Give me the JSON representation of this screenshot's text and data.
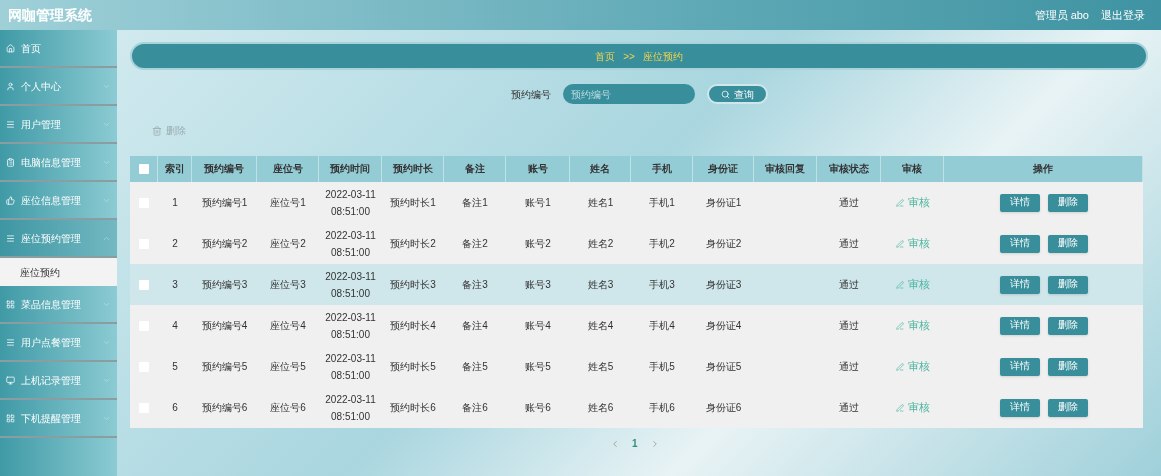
{
  "header": {
    "title": "网咖管理系统",
    "user": "管理员 abo",
    "logout": "退出登录"
  },
  "sidebar": {
    "items": [
      {
        "label": "首页",
        "expandable": false,
        "expanded": false
      },
      {
        "label": "个人中心",
        "expandable": true,
        "expanded": false
      },
      {
        "label": "用户管理",
        "expandable": true,
        "expanded": false
      },
      {
        "label": "电脑信息管理",
        "expandable": true,
        "expanded": false
      },
      {
        "label": "座位信息管理",
        "expandable": true,
        "expanded": false
      },
      {
        "label": "座位预约管理",
        "expandable": true,
        "expanded": true,
        "children": [
          {
            "label": "座位预约",
            "selected": true
          }
        ]
      },
      {
        "label": "菜品信息管理",
        "expandable": true,
        "expanded": false
      },
      {
        "label": "用户点餐管理",
        "expandable": true,
        "expanded": false
      },
      {
        "label": "上机记录管理",
        "expandable": true,
        "expanded": false
      },
      {
        "label": "下机提醒管理",
        "expandable": true,
        "expanded": false
      }
    ]
  },
  "breadcrumb": {
    "home": "首页",
    "separator": ">>",
    "current": "座位预约"
  },
  "search": {
    "label": "预约编号",
    "placeholder": "预约编号",
    "button": "查询"
  },
  "delete_button": "删除",
  "table": {
    "all_checked": false,
    "columns": [
      "索引",
      "预约编号",
      "座位号",
      "预约时间",
      "预约时长",
      "备注",
      "账号",
      "姓名",
      "手机",
      "身份证",
      "审核回复",
      "审核状态",
      "审核",
      "操作"
    ],
    "rows": [
      {
        "checked": false,
        "highlighted": false,
        "cells": [
          "1",
          "预约编号1",
          "座位号1",
          "2022-03-11 08:51:00",
          "预约时长1",
          "备注1",
          "账号1",
          "姓名1",
          "手机1",
          "身份证1",
          "",
          "通过"
        ],
        "review": "审核",
        "actions": [
          "详情",
          "删除"
        ]
      },
      {
        "checked": false,
        "highlighted": false,
        "cells": [
          "2",
          "预约编号2",
          "座位号2",
          "2022-03-11 08:51:00",
          "预约时长2",
          "备注2",
          "账号2",
          "姓名2",
          "手机2",
          "身份证2",
          "",
          "通过"
        ],
        "review": "审核",
        "actions": [
          "详情",
          "删除"
        ]
      },
      {
        "checked": false,
        "highlighted": true,
        "cells": [
          "3",
          "预约编号3",
          "座位号3",
          "2022-03-11 08:51:00",
          "预约时长3",
          "备注3",
          "账号3",
          "姓名3",
          "手机3",
          "身份证3",
          "",
          "通过"
        ],
        "review": "审核",
        "actions": [
          "详情",
          "删除"
        ]
      },
      {
        "checked": false,
        "highlighted": false,
        "cells": [
          "4",
          "预约编号4",
          "座位号4",
          "2022-03-11 08:51:00",
          "预约时长4",
          "备注4",
          "账号4",
          "姓名4",
          "手机4",
          "身份证4",
          "",
          "通过"
        ],
        "review": "审核",
        "actions": [
          "详情",
          "删除"
        ]
      },
      {
        "checked": false,
        "highlighted": false,
        "cells": [
          "5",
          "预约编号5",
          "座位号5",
          "2022-03-11 08:51:00",
          "预约时长5",
          "备注5",
          "账号5",
          "姓名5",
          "手机5",
          "身份证5",
          "",
          "通过"
        ],
        "review": "审核",
        "actions": [
          "详情",
          "删除"
        ]
      },
      {
        "checked": false,
        "highlighted": false,
        "cells": [
          "6",
          "预约编号6",
          "座位号6",
          "2022-03-11 08:51:00",
          "预约时长6",
          "备注6",
          "账号6",
          "姓名6",
          "手机6",
          "身份证6",
          "",
          "通过"
        ],
        "review": "审核",
        "actions": [
          "详情",
          "删除"
        ]
      }
    ]
  },
  "pagination": {
    "pages": [
      {
        "label": "1",
        "selected": true
      }
    ]
  }
}
